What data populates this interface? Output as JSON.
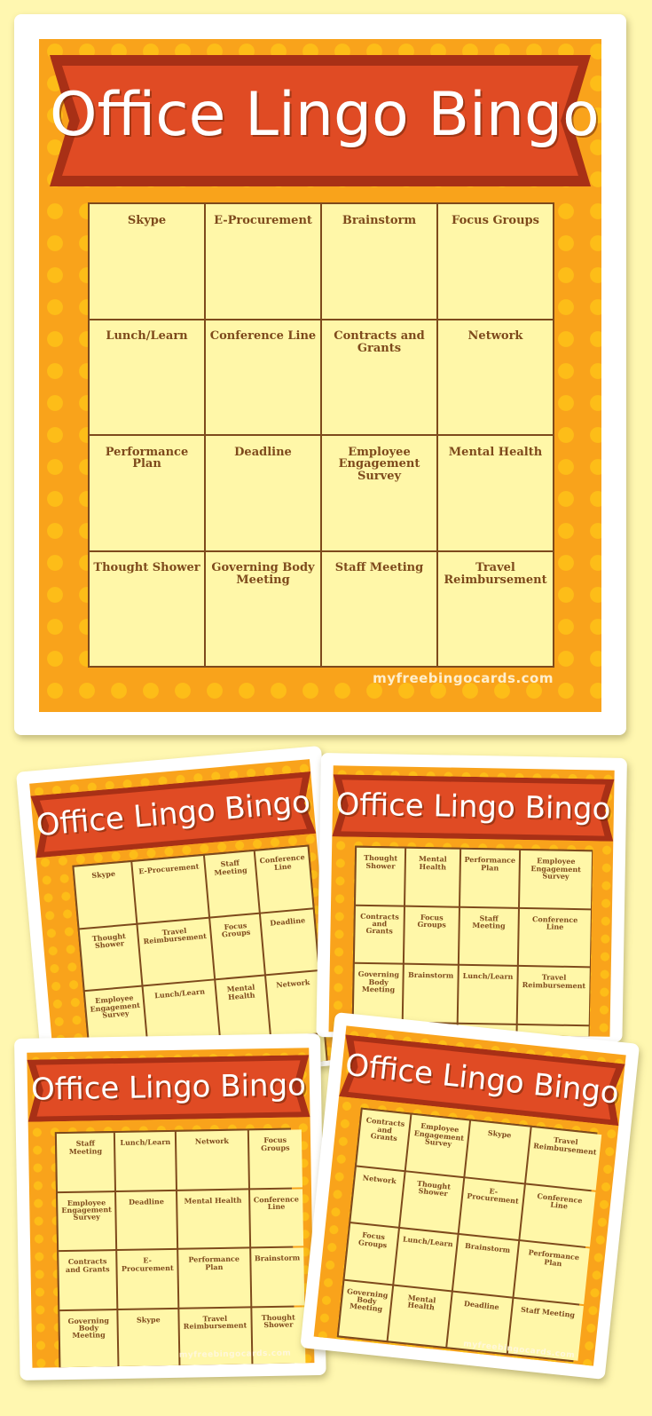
{
  "title": "Office Lingo Bingo",
  "footer": "myfreebingocards.com",
  "colors": {
    "background": "#fff7b0",
    "card_orange": "#f9a31b",
    "dots": "#fdbd18",
    "banner_red": "#e04b24",
    "banner_dark": "#a83016",
    "cell_fill": "#fff7a8",
    "grid_line": "#7e4a1c"
  },
  "main_card": {
    "cells": [
      "Skype",
      "E-Procurement",
      "Brainstorm",
      "Focus Groups",
      "Lunch/Learn",
      "Conference Line",
      "Contracts and Grants",
      "Network",
      "Performance Plan",
      "Deadline",
      "Employee Engagement Survey",
      "Mental Health",
      "Thought Shower",
      "Governing Body Meeting",
      "Staff Meeting",
      "Travel Reimbursement"
    ]
  },
  "preview_cards": [
    {
      "cells": [
        "Skype",
        "E-Procurement",
        "Staff Meeting",
        "Conference Line",
        "Thought Shower",
        "Travel Reimbursement",
        "Focus Groups",
        "Deadline",
        "Employee Engagement Survey",
        "Lunch/Learn",
        "Mental Health",
        "Network",
        "",
        "",
        "",
        ""
      ]
    },
    {
      "cells": [
        "Thought Shower",
        "Mental Health",
        "Performance Plan",
        "Employee Engagement Survey",
        "Contracts and Grants",
        "Focus Groups",
        "Staff Meeting",
        "Conference Line",
        "Governing Body Meeting",
        "Brainstorm",
        "Lunch/Learn",
        "Travel Reimbursement",
        "",
        "",
        "",
        ""
      ]
    },
    {
      "cells": [
        "Staff Meeting",
        "Lunch/Learn",
        "Network",
        "Focus Groups",
        "Employee Engagement Survey",
        "Deadline",
        "Mental Health",
        "Conference Line",
        "Contracts and Grants",
        "E-Procurement",
        "Performance Plan",
        "Brainstorm",
        "Governing Body Meeting",
        "Skype",
        "Travel Reimbursement",
        "Thought Shower"
      ]
    },
    {
      "cells": [
        "Contracts and Grants",
        "Employee Engagement Survey",
        "Skype",
        "Travel Reimbursement",
        "Network",
        "Thought Shower",
        "E-Procurement",
        "Conference Line",
        "Focus Groups",
        "Lunch/Learn",
        "Brainstorm",
        "Performance Plan",
        "Governing Body Meeting",
        "Mental Health",
        "Deadline",
        "Staff Meeting"
      ]
    }
  ]
}
